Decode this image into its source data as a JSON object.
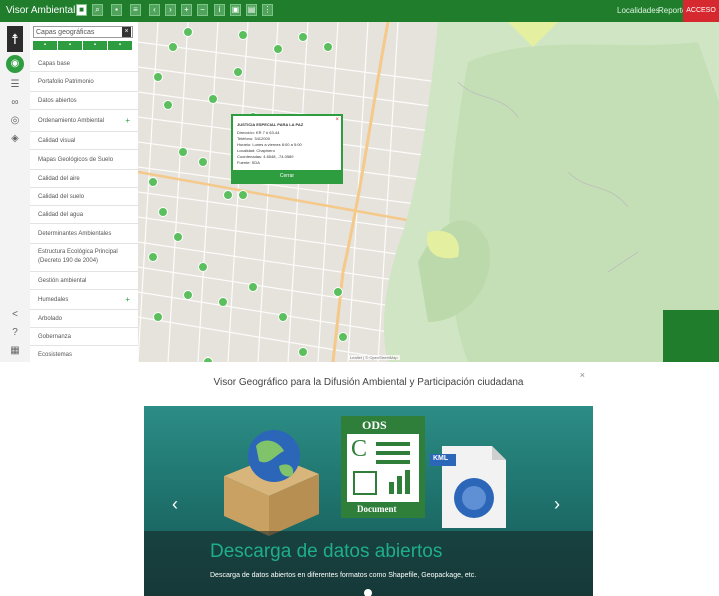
{
  "app": {
    "title": "Visor Ambiental"
  },
  "topbar": {
    "tool_icons": [
      "home-icon",
      "search-icon",
      "ruler-icon",
      "layers-icon",
      "back-icon",
      "forward-icon",
      "zoom-in-icon",
      "zoom-out-icon",
      "info-icon",
      "print-icon",
      "share-icon",
      "menu-icon"
    ],
    "links": [
      "Localidades",
      "Reportes"
    ],
    "red_button": "ACCESO"
  },
  "layer_panel": {
    "search_placeholder": "Capas geográficas",
    "items": [
      {
        "label": "Capas base",
        "expandable": false
      },
      {
        "label": "Portafolio Patrimonio",
        "expandable": false
      },
      {
        "label": "Datos abiertos",
        "expandable": false
      },
      {
        "label": "Ordenamiento Ambiental",
        "expandable": true
      },
      {
        "label": "Calidad visual",
        "expandable": false
      },
      {
        "label": "Mapas Geológicos de Suelo",
        "expandable": false
      },
      {
        "label": "Calidad del aire",
        "expandable": false
      },
      {
        "label": "Calidad del suelo",
        "expandable": false
      },
      {
        "label": "Calidad del agua",
        "expandable": false
      },
      {
        "label": "Determinantes Ambientales",
        "expandable": false
      },
      {
        "label": "Estructura Ecológica Principal (Decreto 190 de 2004)",
        "expandable": false
      },
      {
        "label": "Gestión ambiental",
        "expandable": false
      },
      {
        "label": "Humedales",
        "expandable": true
      },
      {
        "label": "Arbolado",
        "expandable": false
      },
      {
        "label": "Gobernanza",
        "expandable": false
      },
      {
        "label": "Ecosistemas",
        "expandable": false
      }
    ]
  },
  "map": {
    "popup": {
      "title": "JUSTICIA ESPECIAL PARA LA PAZ",
      "lines": [
        "Dirección: KR 7 # 63-44",
        "Teléfono: 3412000",
        "Horario: Lunes a viernes 8:00 a 5:00",
        "Localidad: Chapinero",
        "Coordenadas: 4.6548, -74.0589",
        "Fuente: SDA"
      ],
      "button": "Cerrar"
    },
    "attribution": "Leaflet | © OpenStreetMap"
  },
  "modal": {
    "title": "Visor Geográfico para la Difusión Ambiental y Participación ciudadana",
    "slide": {
      "heading": "Descarga de datos abiertos",
      "subheading": "Descarga de datos abiertos en diferentes formatos como Shapefile, Geopackage, etc.",
      "ods_label": "ODS",
      "document_label": "Document",
      "kml_label": "KML",
      "letter_c": "C"
    }
  },
  "colors": {
    "brand_green": "#1f7d2c",
    "accent_green": "#2e9d3f",
    "alert_red": "#d6282f",
    "carousel_teal": "#2c8d86"
  }
}
